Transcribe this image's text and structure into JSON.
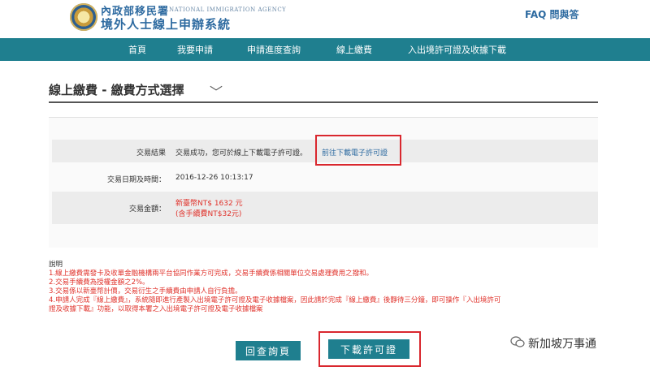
{
  "header": {
    "agency_cn": "內政部移民署",
    "agency_en": "NATIONAL IMMIGRATION AGENCY",
    "system_title": "境外人士線上申辦系統",
    "faq": "FAQ 問與答"
  },
  "nav": {
    "items": [
      "首頁",
      "我要申請",
      "申請進度查詢",
      "線上繳費",
      "入出境許可證及收據下載"
    ]
  },
  "page": {
    "title": "線上繳費 - 繳費方式選擇"
  },
  "result": {
    "result_label": "交易結果",
    "result_text": "交易成功，您可於線上下載電子許可證。",
    "download_link": "前往下載電子許可證",
    "date_label": "交易日期及時間：",
    "date_value": "2016-12-26 10:13:17",
    "amount_label": "交易金額：",
    "amount_value": "新臺幣NT$ 1632 元",
    "fee_note": "(含手續費NT$32元)"
  },
  "notes": {
    "head": "說明",
    "items": [
      "1.線上繳費需發卡及收單金融機構兩平台協同作業方可完成，交易手續費係相關單位交易處理費用之撥和。",
      "2.交易手續費為授權金額之2%。",
      "3.交易係以新臺幣計價，交易衍生之手續費由申請人自行負擔。",
      "4.申請人完成『線上繳費』，系統隨即進行產製入出境電子許可證及電子收據檔案，因此請於完成『線上繳費』後靜待三分鐘，即可操作『入出境許可",
      "證及收據下載』功能，以取得本署之入出境電子許可證及電子收據檔案"
    ]
  },
  "buttons": {
    "back": "回查詢頁",
    "download": "下載許可證"
  },
  "watermark": "新加坡万事通",
  "colors": {
    "nav": "#1f7f8f",
    "brand": "#2d6aa0",
    "alert": "#e0322b",
    "highlight": "#d9272e"
  }
}
